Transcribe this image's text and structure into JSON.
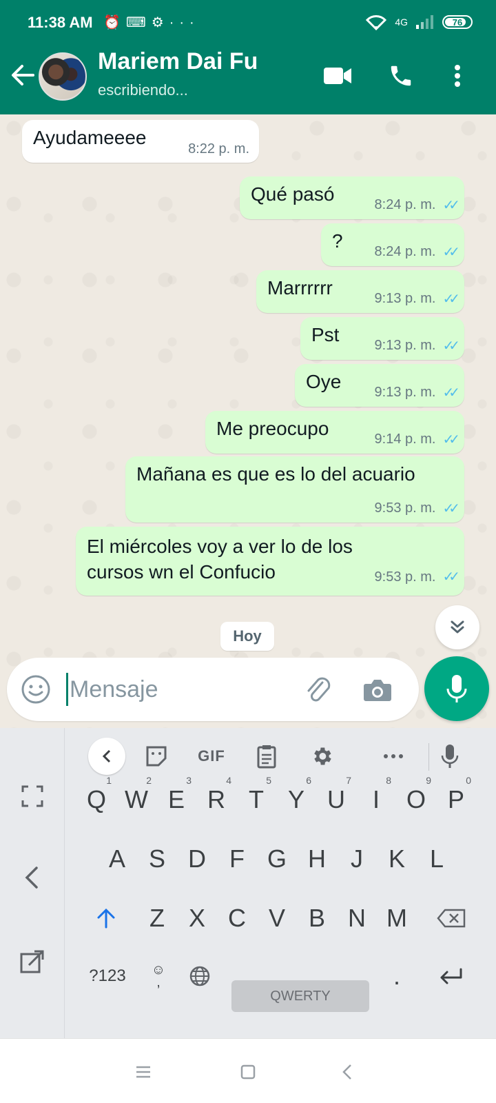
{
  "status_bar": {
    "time": "11:38 AM",
    "network": "4G",
    "battery": "76"
  },
  "header": {
    "contact_name": "Mariem Dai Fu",
    "contact_status": "escribiendo...",
    "accent": "#008069"
  },
  "messages": [
    {
      "dir": "in",
      "text": "Ayudameeee",
      "time": "8:22 p. m."
    },
    {
      "dir": "out",
      "text": "Qué pasó",
      "time": "8:24 p. m."
    },
    {
      "dir": "out",
      "text": "?",
      "time": "8:24 p. m."
    },
    {
      "dir": "out",
      "text": "Marrrrrr",
      "time": "9:13 p. m."
    },
    {
      "dir": "out",
      "text": "Pst",
      "time": "9:13 p. m."
    },
    {
      "dir": "out",
      "text": "Oye",
      "time": "9:13 p. m."
    },
    {
      "dir": "out",
      "text": "Me preocupo",
      "time": "9:14 p. m."
    },
    {
      "dir": "out",
      "text": "Mañana es que es lo del acuario",
      "time": "9:53 p. m."
    },
    {
      "dir": "out",
      "text": "El miércoles voy a ver lo de los cursos wn el Confucio",
      "time": "9:53 p. m."
    }
  ],
  "date_chip": "Hoy",
  "composer": {
    "placeholder": "Mensaje"
  },
  "keyboard": {
    "toolbar": {
      "gif": "GIF"
    },
    "row1": [
      {
        "k": "Q",
        "n": "1"
      },
      {
        "k": "W",
        "n": "2"
      },
      {
        "k": "E",
        "n": "3"
      },
      {
        "k": "R",
        "n": "4"
      },
      {
        "k": "T",
        "n": "5"
      },
      {
        "k": "Y",
        "n": "6"
      },
      {
        "k": "U",
        "n": "7"
      },
      {
        "k": "I",
        "n": "8"
      },
      {
        "k": "O",
        "n": "9"
      },
      {
        "k": "P",
        "n": "0"
      }
    ],
    "row2": [
      "A",
      "S",
      "D",
      "F",
      "G",
      "H",
      "J",
      "K",
      "L"
    ],
    "row3": [
      "Z",
      "X",
      "C",
      "V",
      "B",
      "N",
      "M"
    ],
    "numbers_key": "?123",
    "space_label": "QWERTY",
    "period_key": ".",
    "emoji_comma_key": ","
  }
}
